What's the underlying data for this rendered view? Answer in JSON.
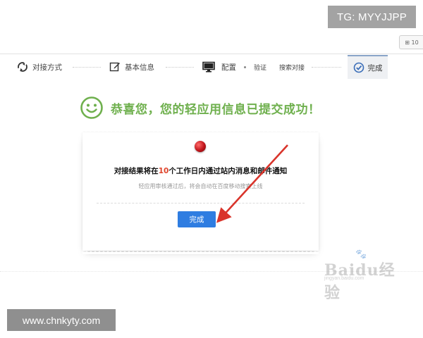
{
  "overlay": {
    "tg_label": "TG: MYYJJPP",
    "site_label": "www.chnkyty.com",
    "corner_tab_label": "⊞ 10"
  },
  "steps": [
    {
      "label": "对接方式",
      "icon": "refresh-icon"
    },
    {
      "label": "基本信息",
      "icon": "edit-icon"
    },
    {
      "label": "配置",
      "icon": "monitor-icon"
    },
    {
      "label": "验证",
      "icon": "dot-icon"
    },
    {
      "label": "搜索对接",
      "icon": "none"
    },
    {
      "label": "完成",
      "icon": "check-circle-icon",
      "active": true
    }
  ],
  "success": {
    "icon": "smiley-icon",
    "title": "恭喜您，您的轻应用信息已提交成功！"
  },
  "card": {
    "message_prefix": "对接结果将在",
    "message_number": "10",
    "message_suffix": "个工作日内通过站内消息和邮件通知",
    "sub_message": "轻应用审核通过后，将会自动在百度移动搜索上线",
    "button_label": "完成"
  },
  "watermark": {
    "brand": "Baidu经验",
    "sub": "jingyan.baidu.com"
  },
  "colors": {
    "success_green": "#6fb04e",
    "primary_button": "#2f7de1",
    "highlight_number": "#e0442b",
    "arrow_red": "#d9342b"
  }
}
